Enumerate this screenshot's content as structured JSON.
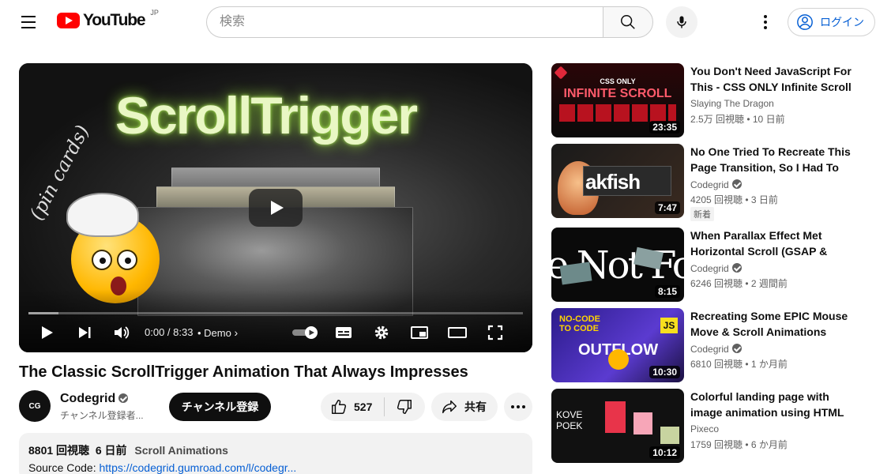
{
  "header": {
    "logo_text": "YouTube",
    "region": "JP",
    "search_placeholder": "検索",
    "login_label": "ログイン"
  },
  "player": {
    "thumbnail_title": "ScrollTrigger",
    "thumbnail_script": "(pin cards)",
    "time": "0:00 / 8:33",
    "chapter": "• Demo",
    "progress_buffered": 0.06
  },
  "video": {
    "title": "The Classic ScrollTrigger Animation That Always Impresses",
    "channel_name": "Codegrid",
    "channel_avatar_text": "CG",
    "subscribers": "チャンネル登録者...",
    "subscribe_label": "チャンネル登録",
    "likes": "527",
    "share_label": "共有"
  },
  "description": {
    "views": "8801 回視聴",
    "date": "6 日前",
    "tag": "Scroll Animations",
    "source_label": "Source Code: ",
    "source_link": "https://codegrid.gumroad.com/l/codegr..."
  },
  "recommendations": [
    {
      "title": "You Don't Need JavaScript For This - CSS ONLY Infinite Scroll",
      "channel": "Slaying The Dragon",
      "meta": "2.5万 回視聴 • 10 日前",
      "duration": "23:35",
      "thumb_text_top": "CSS ONLY",
      "thumb_text": "INFINITE SCROLL",
      "verified": false,
      "badge": ""
    },
    {
      "title": "No One Tried To Recreate This Page Transition, So I Had To",
      "channel": "Codegrid",
      "meta": "4205 回視聴 • 3 日前",
      "duration": "7:47",
      "thumb_text": "akfish",
      "verified": true,
      "badge": "新着"
    },
    {
      "title": "When Parallax Effect Met Horizontal Scroll (GSAP & Locomotive Scroll)",
      "channel": "Codegrid",
      "meta": "6246 回視聴 • 2 週間前",
      "duration": "8:15",
      "thumb_text": "e Not Fo",
      "verified": true,
      "badge": ""
    },
    {
      "title": "Recreating Some EPIC Mouse Move & Scroll Animations With GSAP",
      "channel": "Codegrid",
      "meta": "6810 回視聴 • 1 か月前",
      "duration": "10:30",
      "thumb_text_top": "NO-CODE TO CODE",
      "thumb_text": "OUTFLOW",
      "thumb_badge": "JS",
      "verified": true,
      "badge": ""
    },
    {
      "title": "Colorful landing page with image animation using HTML CSS JS",
      "channel": "Pixeco",
      "meta": "1759 回視聴 • 6 か月前",
      "duration": "10:12",
      "thumb_text": "KOVE POEK",
      "verified": false,
      "badge": ""
    }
  ],
  "colors": {
    "brand_red": "#ff0000",
    "link_blue": "#065fd4",
    "glow_green": "#b7ff3c"
  }
}
